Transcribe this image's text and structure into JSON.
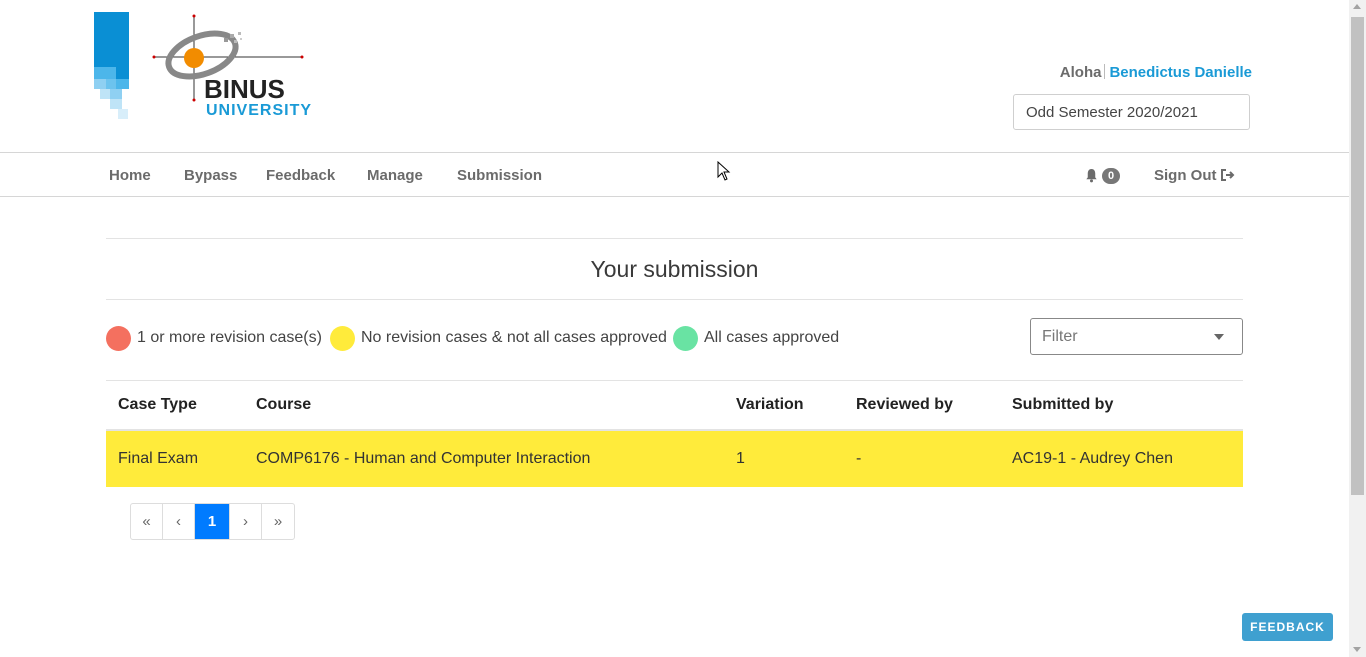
{
  "header": {
    "logo_brand": "BINUS",
    "logo_sub": "UNIVERSITY",
    "greeting": "Aloha",
    "user_name": "Benedictus Danielle",
    "semester": "Odd Semester 2020/2021"
  },
  "nav": {
    "items": [
      {
        "label": "Home"
      },
      {
        "label": "Bypass"
      },
      {
        "label": "Feedback"
      },
      {
        "label": "Manage"
      },
      {
        "label": "Submission"
      }
    ],
    "notification_count": "0",
    "signout_label": "Sign Out"
  },
  "main": {
    "title": "Your submission",
    "legend": [
      {
        "label": "1 or more revision case(s)",
        "color": "#f4705f"
      },
      {
        "label": "No revision cases & not all cases approved",
        "color": "#ffeb3b"
      },
      {
        "label": "All cases approved",
        "color": "#69e3a3"
      }
    ],
    "filter_placeholder": "Filter",
    "table": {
      "columns": [
        "Case Type",
        "Course",
        "Variation",
        "Reviewed by",
        "Submitted by"
      ],
      "rows": [
        {
          "case_type": "Final Exam",
          "course": "COMP6176 - Human and Computer Interaction",
          "variation": "1",
          "reviewed_by": "-",
          "submitted_by": "AC19-1 - Audrey Chen",
          "status_color": "#ffeb3b"
        }
      ]
    },
    "pagination": {
      "first": "«",
      "prev": "‹",
      "current": "1",
      "next": "›",
      "last": "»"
    }
  },
  "feedback_button": "FEEDBACK",
  "colors": {
    "accent": "#1a9ad6",
    "active_page": "#007bff",
    "feedback_button": "#3fa0d0"
  }
}
